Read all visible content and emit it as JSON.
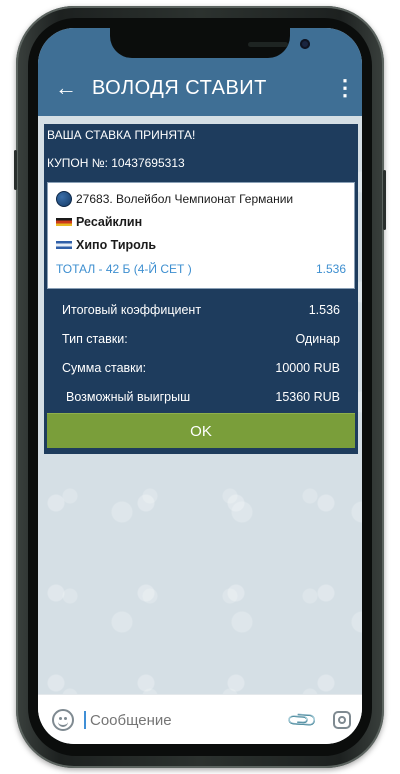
{
  "appbar": {
    "back_icon": "arrow-left-icon",
    "title": "ВОЛОДЯ СТАВИТ",
    "menu_icon": "more-vertical-icon"
  },
  "bet": {
    "accepted": "ВАША СТАВКА ПРИНЯТА!",
    "coupon": "КУПОН №: 10437695313",
    "event": {
      "title": "27683. Волейбол Чемпионат Германии",
      "team1": "Ресайклин",
      "team2": "Хипо Тироль",
      "market": "ТОТАЛ - 42 Б (4-Й СЕТ )",
      "odds": "1.536"
    },
    "summary": [
      {
        "label": "Итоговый коэффициент",
        "value": "1.536"
      },
      {
        "label": "Тип ставки:",
        "value": "Одинар"
      },
      {
        "label": "Сумма ставки:",
        "value": "10000 RUB"
      },
      {
        "label": "Возможный выигрыш",
        "value": "15360 RUB"
      }
    ],
    "ok_label": "OK"
  },
  "input": {
    "placeholder": "Сообщение",
    "emoji_icon": "smile-icon",
    "attach_icon": "paperclip-icon",
    "camera_icon": "camera-icon"
  },
  "colors": {
    "appbar": "#3f6f95",
    "card": "#1e3c5d",
    "ok_button": "#7a9e3a",
    "market_text": "#3e8fd0"
  }
}
